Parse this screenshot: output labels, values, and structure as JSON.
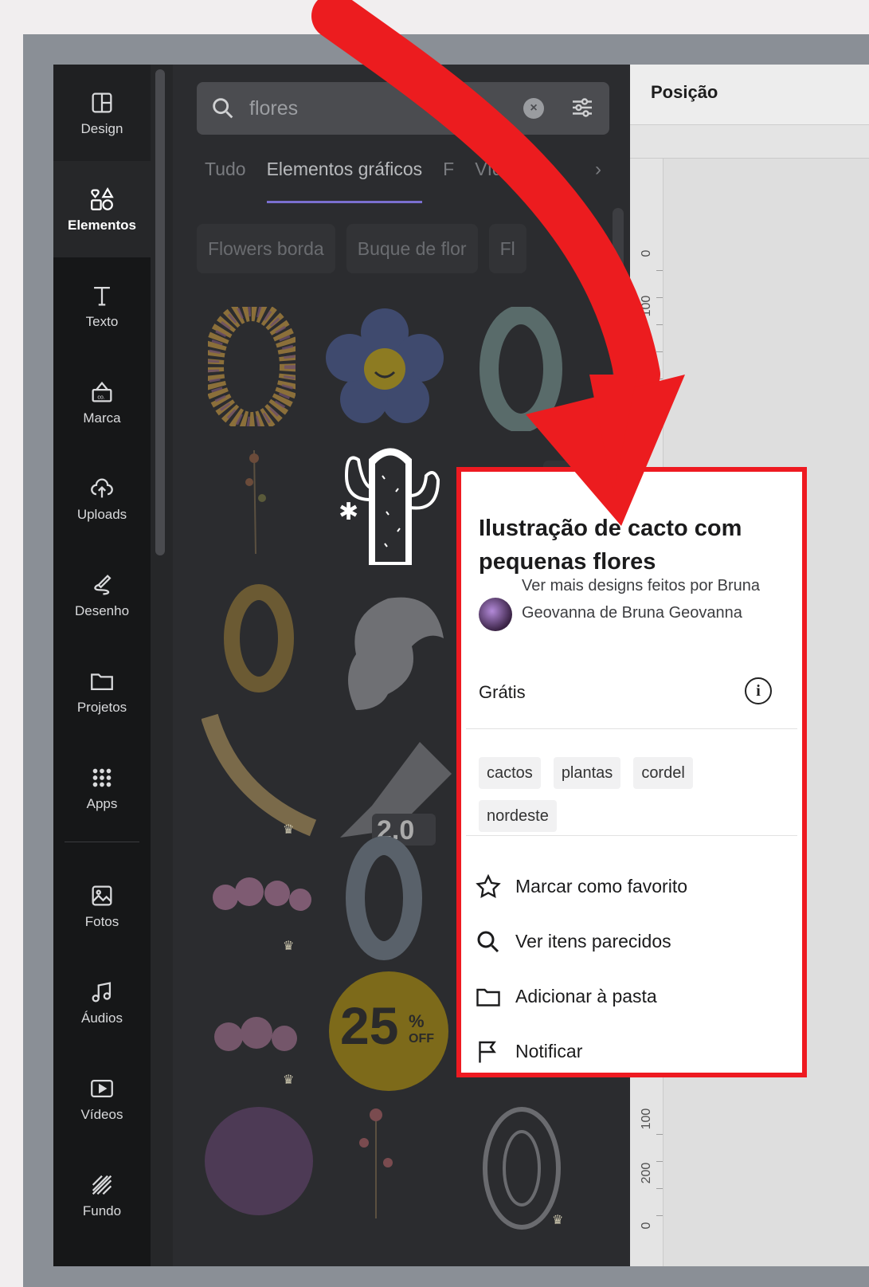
{
  "rail": {
    "items": [
      {
        "label": "Design",
        "icon": "layout-icon"
      },
      {
        "label": "Elementos",
        "icon": "shapes-icon"
      },
      {
        "label": "Texto",
        "icon": "text-icon"
      },
      {
        "label": "Marca",
        "icon": "brand-icon"
      },
      {
        "label": "Uploads",
        "icon": "cloud-upload-icon"
      },
      {
        "label": "Desenho",
        "icon": "draw-icon"
      },
      {
        "label": "Projetos",
        "icon": "folder-icon"
      },
      {
        "label": "Apps",
        "icon": "apps-grid-icon"
      },
      {
        "label": "Fotos",
        "icon": "photo-icon"
      },
      {
        "label": "Áudios",
        "icon": "music-icon"
      },
      {
        "label": "Vídeos",
        "icon": "video-icon"
      },
      {
        "label": "Fundo",
        "icon": "background-pattern-icon"
      }
    ],
    "active": "Elementos"
  },
  "search": {
    "value": "flores"
  },
  "tabs": [
    "Tudo",
    "Elementos gráficos",
    "F",
    "Víde"
  ],
  "chips": [
    "Flowers borda",
    "Buque de flor",
    "Fl"
  ],
  "canvas": {
    "top_label": "Posição",
    "ruler_ticks": [
      "0",
      "100",
      "200",
      "100",
      "200",
      "0"
    ]
  },
  "popup": {
    "title": "Ilustração de cacto com pequenas flores",
    "author": "Ver mais designs feitos por Bruna Geovanna de Bruna Geovanna",
    "price": "Grátis",
    "tags": [
      "cactos",
      "plantas",
      "cordel",
      "nordeste"
    ],
    "menu": [
      {
        "label": "Marcar como favorito",
        "icon": "star-icon"
      },
      {
        "label": "Ver itens parecidos",
        "icon": "search-icon"
      },
      {
        "label": "Adicionar à pasta",
        "icon": "folder-icon"
      },
      {
        "label": "Notificar",
        "icon": "flag-icon"
      }
    ]
  },
  "thumbs": {
    "discount": "25",
    "discount_pct": "%",
    "discount_off": "OFF",
    "usb_label": "2.0"
  },
  "colors": {
    "highlight": "#ee1a21",
    "tab_accent": "#7a6fd0"
  }
}
